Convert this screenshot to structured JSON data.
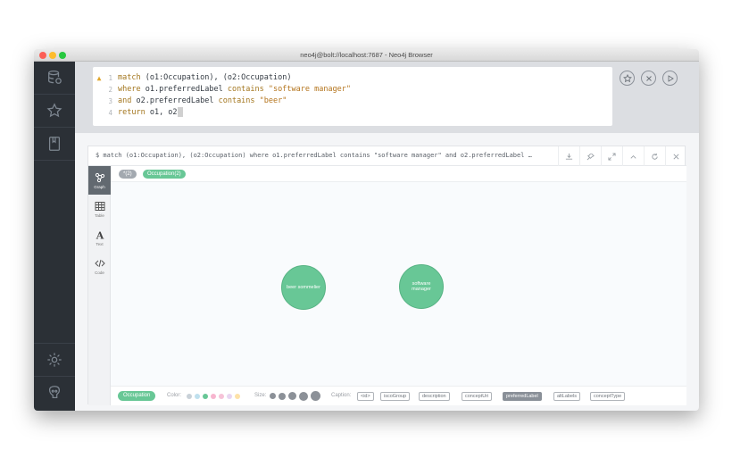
{
  "window": {
    "title": "neo4j@bolt://localhost:7687 - Neo4j Browser"
  },
  "sidebar": {
    "items": [
      {
        "icon": "database-icon"
      },
      {
        "icon": "star-icon"
      },
      {
        "icon": "document-icon"
      },
      {
        "icon": "gear-icon"
      },
      {
        "icon": "about-icon"
      }
    ]
  },
  "editor": {
    "lines": [
      {
        "n": "1",
        "kw": "match",
        "rest": " (o1:Occupation), (o2:Occupation)",
        "str": ""
      },
      {
        "n": "2",
        "kw": "where",
        "rest": " o1.preferredLabel ",
        "kw2": "contains",
        "str": "\"software manager\""
      },
      {
        "n": "3",
        "kw": "and",
        "rest": " o2.preferredLabel ",
        "kw2": "contains",
        "str": "\"beer\""
      },
      {
        "n": "4",
        "kw": "return",
        "rest": " o1, o2",
        "str": ""
      }
    ],
    "buttons": [
      "favorite-icon",
      "clear-icon",
      "run-icon"
    ]
  },
  "frame": {
    "query": "$ match (o1:Occupation), (o2:Occupation) where o1.preferredLabel contains \"software manager\" and o2.preferredLabel …",
    "tabs": [
      {
        "label": "Graph",
        "active": true
      },
      {
        "label": "Table",
        "active": false
      },
      {
        "label": "Text",
        "active": false
      },
      {
        "label": "Code",
        "active": false
      }
    ],
    "badges": {
      "all": "*(2)",
      "occupation": "Occupation(2)"
    },
    "nodes": [
      {
        "label": "beer sommelier"
      },
      {
        "label": "software manager"
      }
    ],
    "footer": {
      "label": "Occupation",
      "color_label": "Color:",
      "size_label": "Size:",
      "caption_label": "Caption:",
      "captions": [
        "<id>",
        "iscoGroup",
        "description",
        "conceptUri",
        "preferredLabel",
        "altLabels",
        "conceptType"
      ],
      "selected_caption": "preferredLabel",
      "colors": [
        "#c9d1d8",
        "#bfe0ee",
        "#9bd2e0",
        "#68c796",
        "#f7b6cf",
        "#f6c3d8",
        "#e8d6f2",
        "#fde2a8"
      ]
    }
  },
  "colors": {
    "node": "#68c796",
    "sidebar": "#2b3036",
    "keyword": "#a3761e"
  }
}
